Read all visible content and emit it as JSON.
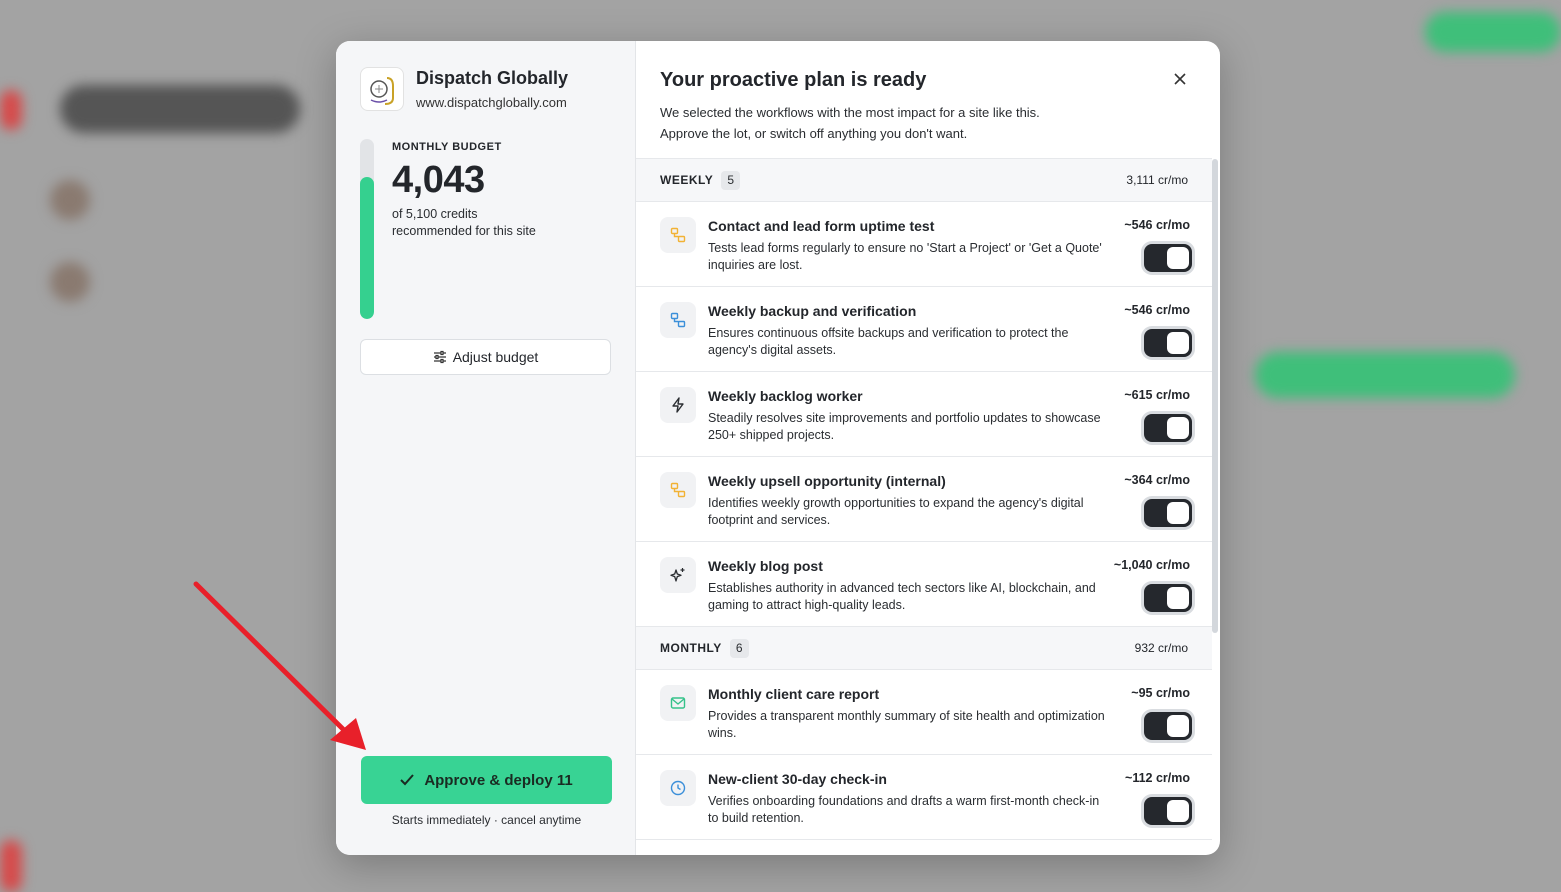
{
  "site": {
    "name": "Dispatch Globally",
    "url": "www.dispatchglobally.com"
  },
  "budget": {
    "label": "MONTHLY BUDGET",
    "value": "4,043",
    "of_text": "of 5,100 credits",
    "recommend_text": "recommended for this site",
    "fill_fraction": 0.79
  },
  "adjust_label": "Adjust budget",
  "approve": {
    "label": "Approve & deploy 11",
    "note": "Starts immediately · cancel anytime"
  },
  "header": {
    "title": "Your proactive plan is ready",
    "subtitle": "We selected the workflows with the most impact for a site like this.\nApprove the lot, or switch off anything you don't want."
  },
  "sections": [
    {
      "title": "WEEKLY",
      "count": "5",
      "total": "3,111 cr/mo",
      "items": [
        {
          "icon": "workflow-icon",
          "color": "#f2b234",
          "title": "Contact and lead form uptime test",
          "desc": "Tests lead forms regularly to ensure no 'Start a Project' or 'Get a Quote' inquiries are lost.",
          "cost": "~546 cr/mo",
          "enabled": true
        },
        {
          "icon": "workflow-icon",
          "color": "#3b8fd9",
          "title": "Weekly backup and verification",
          "desc": "Ensures continuous offsite backups and verification to protect the agency's digital assets.",
          "cost": "~546 cr/mo",
          "enabled": true
        },
        {
          "icon": "lightning-icon",
          "color": "#2a2d31",
          "title": "Weekly backlog worker",
          "desc": "Steadily resolves site improvements and portfolio updates to showcase 250+ shipped projects.",
          "cost": "~615 cr/mo",
          "enabled": true
        },
        {
          "icon": "workflow-icon",
          "color": "#f2b234",
          "title": "Weekly upsell opportunity (internal)",
          "desc": "Identifies weekly growth opportunities to expand the agency's digital footprint and services.",
          "cost": "~364 cr/mo",
          "enabled": true
        },
        {
          "icon": "sparkles-icon",
          "color": "#2a2d31",
          "title": "Weekly blog post",
          "desc": "Establishes authority in advanced tech sectors like AI, blockchain, and gaming to attract high-quality leads.",
          "cost": "~1,040 cr/mo",
          "enabled": true
        }
      ]
    },
    {
      "title": "MONTHLY",
      "count": "6",
      "total": "932 cr/mo",
      "items": [
        {
          "icon": "mail-icon",
          "color": "#35c28a",
          "title": "Monthly client care report",
          "desc": "Provides a transparent monthly summary of site health and optimization wins.",
          "cost": "~95 cr/mo",
          "enabled": true
        },
        {
          "icon": "clock-icon",
          "color": "#3b8fd9",
          "title": "New-client 30-day check-in",
          "desc": "Verifies onboarding foundations and drafts a warm first-month check-in to build retention.",
          "cost": "~112 cr/mo",
          "enabled": true
        }
      ]
    }
  ],
  "colors": {
    "accent": "#38d394",
    "budget_fill": "#35d08f",
    "annotation_arrow": "#e8202a"
  }
}
